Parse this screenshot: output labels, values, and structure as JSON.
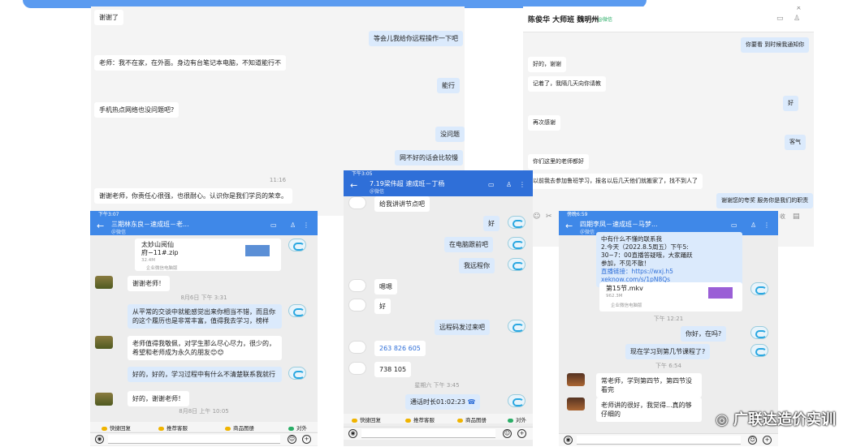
{
  "colors": {
    "accent": "#5b9bf0",
    "wecom_green": "#2aae67",
    "phone_nav": "#3f88e8"
  },
  "p1": {
    "msgs": [
      "谢谢了",
      "等会儿我给你远程操作一下吧",
      "老师：我不在家，在外面。身边有台笔记本电脑，不知道能行不",
      "能行",
      "手机热点网络也没问题吧?",
      "没问题",
      "网不好的话会比较慢",
      "谢谢老师，你责任心很强，也很耐心。认识你是我们学员的荣幸。"
    ],
    "time": "11:16"
  },
  "p2": {
    "title": "陈俊华 大师班 魏明州",
    "tag": "@微信",
    "msgs": [
      "你要看 到时候我通知你",
      "好的，谢谢",
      "记着了，我隔几天向你请教",
      "好",
      "再次感谢",
      "客气",
      "你们这里的老师都好",
      "以前我去参加鲁班学习，报名以后几天他们就搬家了，找不到人了",
      "谢谢您的夸奖 服务你是我们的职责"
    ],
    "tools": "收"
  },
  "phoneA": {
    "status": "下午3:07",
    "title": "三期林东良－速成班－老...",
    "sub": "＠微信",
    "file": {
      "name1": "太妙山阅仙",
      "name2": "府−11#.zip",
      "size": "32.4M",
      "src": "企业微信电脑版"
    },
    "msgs": [
      "谢谢老师！",
      "从平常的交谈中就能感觉出来你相当不错，而且你的这个履历也是非常丰富，值得我去学习，榜样",
      "老师值得我敬佩，对学生那么尽心尽力，很少的，希望和老师成为永久的朋友😊😊",
      "好的，好的，学习过程中有什么不清楚联系我就行",
      "好的，谢谢老师！"
    ],
    "ts1": "8月6日  下午 3:31",
    "ts2": "8月8日  上午 10:05",
    "quick": [
      "快捷回复",
      "推荐客服",
      "商品图册",
      "对外"
    ]
  },
  "phoneB": {
    "status": "下午3:05",
    "title": "7.19梁伟超 速成班－丁杨",
    "sub": "＠微信",
    "msgs": [
      "给我讲讲节点吧",
      "好",
      "在电脑跟前吧",
      "我远程你",
      "嗯嗯",
      "好",
      "远程码发过来吧",
      "263 826 605",
      "738 105",
      "通话时长01:02:23"
    ],
    "ts": "星期六  下午 3:45",
    "quick": [
      "快捷回复",
      "推荐客服",
      "商品图册",
      "对外"
    ]
  },
  "phoneC": {
    "status": "傍晚6:59",
    "title": "四期李凤－速成班－马梦...",
    "sub": "＠微信",
    "notice": [
      "中有什么不懂的联系我",
      "2.今天（2022.8.5周五）下午5:",
      "30−7：00直播答疑哦，大家踊跃",
      "参加，不见不散！",
      "直播链接：https://wxj.h5",
      "xeknow.com/s/1pN8Qs"
    ],
    "file": {
      "name": "第15节.mkv",
      "size": "962.3M",
      "src": "企业微信电脑版"
    },
    "ts1": "下午 12:21",
    "ts2": "下午 6:54",
    "msgs": [
      "你好，在吗?",
      "现在学习到第几节课程了?",
      "常老师，学到第四节，第四节没看完",
      "老师讲的很好，我觉得...真的够仔细的"
    ],
    "watermark": "广联达造价实训"
  }
}
